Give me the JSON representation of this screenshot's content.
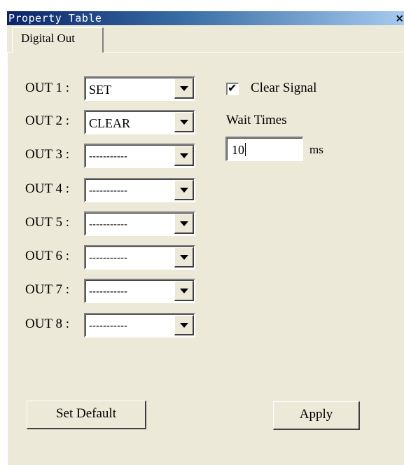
{
  "window": {
    "title": "Property Table",
    "close_glyph": "×"
  },
  "tabs": [
    {
      "label": "Digital Out",
      "active": true
    }
  ],
  "outputs": [
    {
      "label": "OUT 1 :",
      "value": "SET"
    },
    {
      "label": "OUT 2 :",
      "value": "CLEAR"
    },
    {
      "label": "OUT 3 :",
      "value": "-----------"
    },
    {
      "label": "OUT 4 :",
      "value": "-----------"
    },
    {
      "label": "OUT 5 :",
      "value": "-----------"
    },
    {
      "label": "OUT 6 :",
      "value": "-----------"
    },
    {
      "label": "OUT 7 :",
      "value": "-----------"
    },
    {
      "label": "OUT 8 :",
      "value": "-----------"
    }
  ],
  "clear_signal": {
    "label": "Clear Signal",
    "checked": true,
    "check_glyph": "✔"
  },
  "wait_times": {
    "label": "Wait Times",
    "value": "10",
    "unit": "ms"
  },
  "buttons": {
    "set_default": "Set Default",
    "apply": "Apply"
  },
  "colors": {
    "titlebar_start": "#0a246a",
    "titlebar_end": "#a6caf0",
    "panel_background": "#ece9d8"
  },
  "icons": {
    "close": "close-icon",
    "dropdown": "chevron-down-icon",
    "check": "check-icon"
  }
}
